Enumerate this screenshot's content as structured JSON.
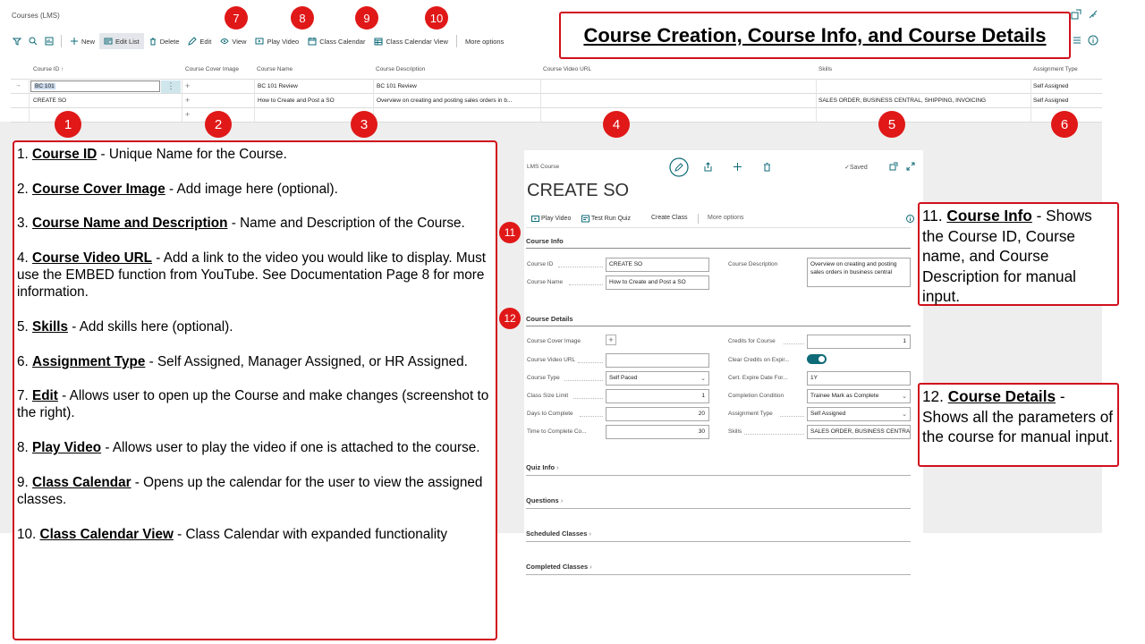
{
  "page": {
    "title": "Courses (LMS)"
  },
  "toolbar": {
    "new": "New",
    "edit_list": "Edit List",
    "delete": "Delete",
    "edit": "Edit",
    "view": "View",
    "play_video": "Play Video",
    "class_calendar": "Class Calendar",
    "class_calendar_view": "Class Calendar View",
    "more_options": "More options"
  },
  "headline": "Course Creation, Course Info, and Course Details",
  "list": {
    "columns": [
      "Course ID ↑",
      "Course Cover Image",
      "Course Name",
      "Course Description",
      "Course Video URL",
      "Skills",
      "Assignment Type"
    ],
    "rows": [
      {
        "id": "BC 101",
        "name": "BC 101 Review",
        "description": "BC 101 Review",
        "skills": "",
        "assignment": "Self Assigned"
      },
      {
        "id": "CREATE SO",
        "name": "How to Create and Post a SO",
        "description": "Overview on creating and posting sales orders in b...",
        "skills": "SALES ORDER, BUSINESS CENTRAL, SHIPPING, INVOICING",
        "assignment": "Self Assigned"
      }
    ]
  },
  "badges": [
    "1",
    "2",
    "3",
    "4",
    "5",
    "6",
    "7",
    "8",
    "9",
    "10",
    "11",
    "12"
  ],
  "notes": [
    {
      "num": "1.",
      "term": "Course ID",
      "text": " - Unique Name for the Course."
    },
    {
      "num": "2.",
      "term": "Course Cover Image",
      "text": " - Add image here (optional)."
    },
    {
      "num": "3.",
      "term": "Course Name and Description",
      "text": " - Name and Description of the Course."
    },
    {
      "num": "4.",
      "term": "Course Video URL",
      "text": " - Add a link to the video you would like to display. Must use the EMBED function from YouTube. See Documentation Page 8 for more information."
    },
    {
      "num": "5.",
      "term": "Skills",
      "text": " - Add skills here (optional)."
    },
    {
      "num": "6.",
      "term": "Assignment Type",
      "text": " - Self Assigned, Manager Assigned, or HR Assigned."
    },
    {
      "num": "7.",
      "term": "Edit",
      "text": " - Allows user to open up the Course and make changes (screenshot to the right)."
    },
    {
      "num": "8.",
      "term": "Play Video",
      "text": " - Allows user to play the video if one is attached to the course."
    },
    {
      "num": "9.",
      "term": "Class Calendar",
      "text": " - Opens up the calendar for the user to view the assigned classes."
    },
    {
      "num": "10.",
      "term": "Class Calendar View",
      "text": " - Class Calendar with expanded functionality"
    }
  ],
  "card": {
    "crumb": "LMS Course",
    "saved": "✓Saved",
    "title": "CREATE SO",
    "actions": {
      "play_video": "Play Video",
      "test_run_quiz": "Test Run Quiz",
      "create_class": "Create Class",
      "more_options": "More options"
    },
    "course_info": {
      "heading": "Course Info",
      "course_id_label": "Course ID",
      "course_id": "CREATE SO",
      "course_name_label": "Course Name",
      "course_name": "How to Create and Post a SO",
      "course_description_label": "Course Description",
      "course_description": "Overview on creating and posting sales orders in business central"
    },
    "course_details": {
      "heading": "Course Details",
      "cover_image_label": "Course Cover Image",
      "video_url_label": "Course Video URL",
      "course_type_label": "Course Type",
      "course_type": "Self Paced",
      "class_size_label": "Class Size Limit",
      "class_size": "1",
      "days_label": "Days to Complete",
      "days": "20",
      "time_label": "Time to Complete Co...",
      "time": "30",
      "credits_label": "Credits for Course",
      "credits": "1",
      "clear_credits_label": "Clear Credits on Expir...",
      "expire_label": "Cert. Expire Date For...",
      "expire": "1Y",
      "completion_label": "Completion Condition",
      "completion": "Trainee Mark as Complete",
      "assignment_label": "Assignment Type",
      "assignment": "Self Assigned",
      "skills_label": "Skills",
      "skills": "SALES ORDER, BUSINESS CENTRAL"
    },
    "sections": [
      "Quiz Info",
      "Questions",
      "Scheduled Classes",
      "Completed Classes"
    ]
  },
  "callouts": {
    "info": {
      "num": "11.",
      "term": "Course Info",
      "text": " - Shows the Course ID, Course name, and Course Description for manual input."
    },
    "details": {
      "num": "12.",
      "term": "Course Details",
      "text": " - Shows all the parameters of the course for manual input."
    }
  },
  "colors": {
    "callout_red": "#d0101c",
    "badge_red": "#e01818",
    "toggle": "#0f6b78",
    "row_select": "#cfe6ec"
  }
}
